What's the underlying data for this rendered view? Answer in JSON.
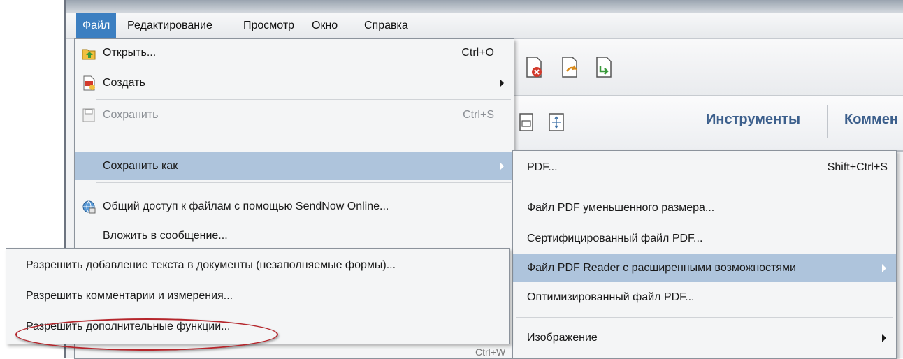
{
  "menubar": {
    "items": [
      {
        "label": "Файл",
        "active": true
      },
      {
        "label": "Редактирование",
        "active": false
      },
      {
        "label": "Просмотр",
        "active": false
      },
      {
        "label": "Окно",
        "active": false
      },
      {
        "label": "Справка",
        "active": false
      }
    ]
  },
  "toolbar": {
    "tools_label": "Инструменты",
    "comments_label": "Коммен"
  },
  "file_menu": {
    "open": {
      "label": "Открыть...",
      "shortcut": "Ctrl+O",
      "icon": "open-folder-icon"
    },
    "create": {
      "label": "Создать",
      "icon": "create-document-icon"
    },
    "save": {
      "label": "Сохранить",
      "shortcut": "Ctrl+S",
      "icon": "save-disk-icon"
    },
    "save_as": {
      "label": "Сохранить как"
    },
    "share": {
      "label": "Общий доступ к файлам с помощью SendNow Online...",
      "icon": "share-globe-icon"
    },
    "attach": {
      "label": "Вложить в сообщение..."
    },
    "partial_shortcut": "Ctrl+W"
  },
  "save_as_submenu": {
    "pdf": {
      "label": "PDF...",
      "shortcut": "Shift+Ctrl+S"
    },
    "reduced": {
      "label": "Файл PDF уменьшенного размера..."
    },
    "certified": {
      "label": "Сертифицированный файл PDF..."
    },
    "reader_extended": {
      "label": "Файл PDF Reader с расширенными возможностями"
    },
    "optimized": {
      "label": "Оптимизированный файл PDF..."
    },
    "image": {
      "label": "Изображение"
    }
  },
  "reader_submenu": {
    "items": [
      {
        "label": "Разрешить добавление текста в документы (незаполняемые формы)..."
      },
      {
        "label": "Разрешить комментарии и измерения..."
      },
      {
        "label": "Разрешить дополнительные функции..."
      }
    ]
  },
  "colors": {
    "menu_active": "#3c7fc1",
    "item_highlight": "#aec4dc",
    "ellipse": "#b5262c",
    "tools_text": "#3c5f8c"
  }
}
